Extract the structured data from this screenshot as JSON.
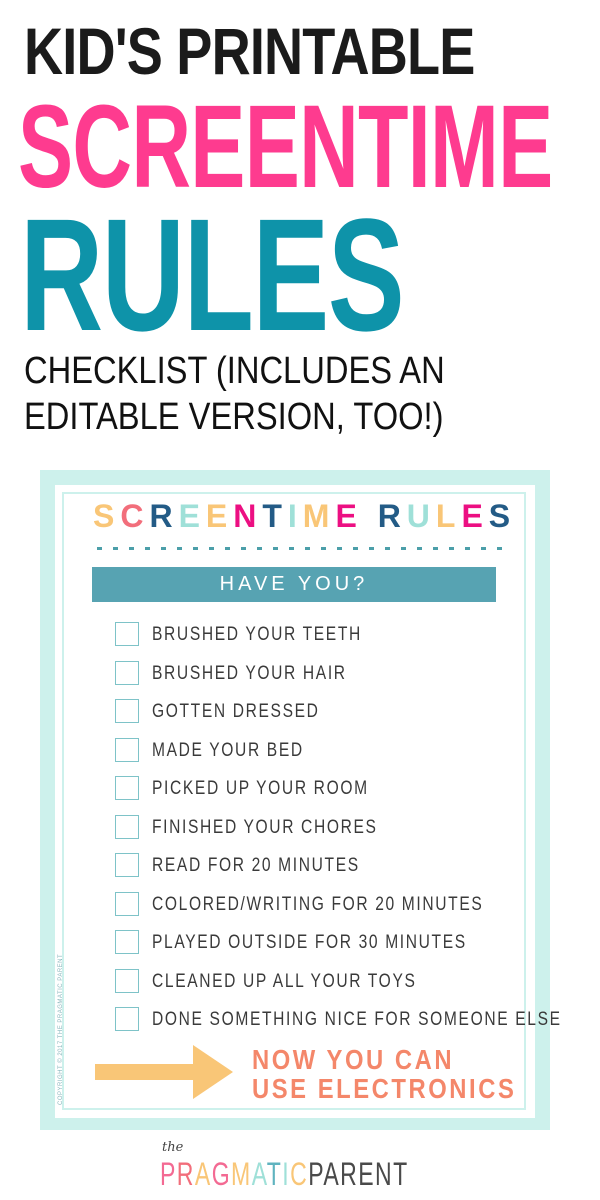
{
  "colors": {
    "pink": "#fe3b8f",
    "teal": "#0e93a9",
    "mint": "#cdf1ec",
    "bar": "#57a3b2",
    "coral": "#f4876a",
    "peach": "#f9c677",
    "navy": "#235b86",
    "aqua": "#9fe0d8",
    "magenta": "#ec0f82",
    "salmon": "#f26e7b"
  },
  "header": {
    "line1": "KID'S PRINTABLE",
    "line2": "SCREENTIME",
    "line3": "RULES",
    "subtitle_line1": "CHECKLIST (INCLUDES AN",
    "subtitle_line2": "EDITABLE VERSION, TOO!)"
  },
  "card": {
    "title_letters": [
      {
        "ch": "S",
        "color": "#f9c677"
      },
      {
        "ch": "C",
        "color": "#f26e7b"
      },
      {
        "ch": "R",
        "color": "#235b86"
      },
      {
        "ch": "E",
        "color": "#9fe0d8"
      },
      {
        "ch": "E",
        "color": "#f9c677"
      },
      {
        "ch": "N",
        "color": "#ec0f82"
      },
      {
        "ch": "T",
        "color": "#235b86"
      },
      {
        "ch": "I",
        "color": "#9fe0d8"
      },
      {
        "ch": "M",
        "color": "#f9c677"
      },
      {
        "ch": "E",
        "color": "#ec0f82"
      },
      {
        "ch": " ",
        "color": "#ffffff"
      },
      {
        "ch": "R",
        "color": "#235b86"
      },
      {
        "ch": "U",
        "color": "#9fe0d8"
      },
      {
        "ch": "L",
        "color": "#f9c677"
      },
      {
        "ch": "E",
        "color": "#ec0f82"
      },
      {
        "ch": "S",
        "color": "#235b86"
      }
    ],
    "banner": "HAVE YOU?",
    "items": [
      {
        "label": "BRUSHED YOUR TEETH",
        "checked": false
      },
      {
        "label": "BRUSHED YOUR HAIR",
        "checked": false
      },
      {
        "label": "GOTTEN DRESSED",
        "checked": false
      },
      {
        "label": "MADE YOUR BED",
        "checked": false
      },
      {
        "label": "PICKED UP YOUR ROOM",
        "checked": false
      },
      {
        "label": "FINISHED YOUR CHORES",
        "checked": false
      },
      {
        "label": "READ FOR 20 MINUTES",
        "checked": false
      },
      {
        "label": "COLORED/WRITING FOR 20 MINUTES",
        "checked": false
      },
      {
        "label": "PLAYED OUTSIDE FOR 30 MINUTES",
        "checked": false
      },
      {
        "label": "CLEANED UP ALL YOUR TOYS",
        "checked": false
      },
      {
        "label": "DONE SOMETHING NICE FOR SOMEONE ELSE",
        "checked": false
      }
    ],
    "cta_line1": "NOW YOU CAN",
    "cta_line2": "USE ELECTRONICS",
    "arrow_icon": "right-arrow-icon",
    "copyright": "COPYRIGHT © 2017 THE PRAGMATIC PARENT"
  },
  "logo": {
    "prefix": "the",
    "word1_letters": [
      {
        "ch": "P",
        "color": "#f36a93"
      },
      {
        "ch": "R",
        "color": "#f26e7b"
      },
      {
        "ch": "A",
        "color": "#f9c677"
      },
      {
        "ch": "G",
        "color": "#f36a93"
      },
      {
        "ch": "M",
        "color": "#f9c677"
      },
      {
        "ch": "A",
        "color": "#9fe0d8"
      },
      {
        "ch": "T",
        "color": "#5fb3bf"
      },
      {
        "ch": "I",
        "color": "#9fe0d8"
      },
      {
        "ch": "C",
        "color": "#f9c677"
      }
    ],
    "word2": "PARENT",
    "word2_color": "#4a4a4a"
  }
}
